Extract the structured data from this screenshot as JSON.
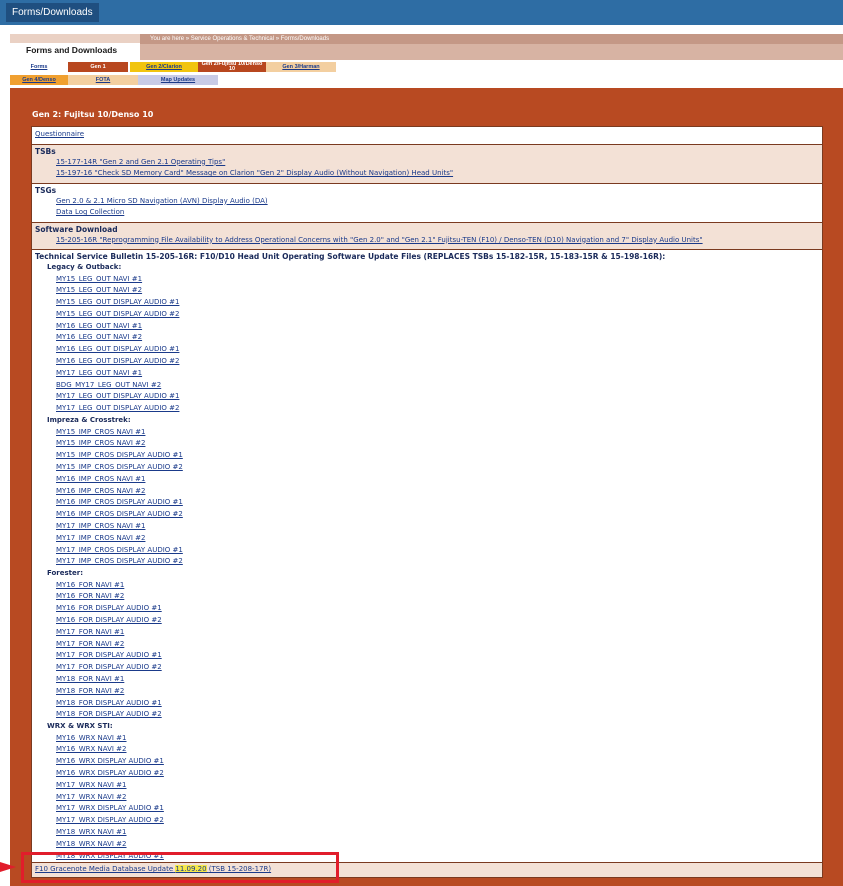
{
  "topbar": {
    "tab": "Forms/Downloads"
  },
  "banner": {
    "breadcrumb": "You are here » Service Operations & Technical » Forms/Downloads",
    "title": "Forms and Downloads"
  },
  "tabs_row1": [
    {
      "label": "Forms",
      "style": "white"
    },
    {
      "label": "Gen 1",
      "style": "active"
    },
    {
      "label": "Gen 2/Clarion",
      "style": "yellow"
    },
    {
      "label": "Gen 2/Fujitsu 10/Denso 10",
      "style": "active"
    },
    {
      "label": "Gen 3/Harman",
      "style": "peach"
    }
  ],
  "tabs_row2": [
    {
      "label": "Gen 4/Denso",
      "style": "orange"
    },
    {
      "label": "FOTA",
      "style": "peach"
    },
    {
      "label": "Map Updates",
      "style": "lilac"
    }
  ],
  "page_title": "Gen 2: Fujitsu 10/Denso 10",
  "questionnaire": "Questionnaire",
  "tsbs": {
    "heading": "TSBs",
    "items": [
      "15-177-14R \"Gen 2 and Gen 2.1 Operating Tips\"",
      "15-197-16 \"Check SD Memory Card\" Message on Clarion \"Gen 2\" Display Audio (Without Navigation) Head Units\""
    ]
  },
  "tsgs": {
    "heading": "TSGs",
    "items": [
      "Gen 2.0 & 2.1 Micro SD Navigation (AVN) Display Audio (DA)",
      "Data Log Collection"
    ]
  },
  "software": {
    "heading": "Software Download",
    "items": [
      "15-205-16R \"Reprogramming File Availability to Address Operational Concerns with \"Gen 2.0\" and \"Gen 2.1\" Fujitsu-TEN (F10) / Denso-TEN (D10) Navigation and 7\" Display Audio Units\""
    ]
  },
  "bulletin": {
    "heading": "Technical Service Bulletin 15-205-16R: F10/D10 Head Unit Operating Software Update Files (REPLACES TSBs 15-182-15R, 15-183-15R & 15-198-16R):",
    "groups": [
      {
        "name": "Legacy & Outback:",
        "items": [
          "MY15_LEG_OUT NAVI #1",
          "MY15_LEG_OUT NAVI #2",
          "MY15_LEG_OUT DISPLAY AUDIO #1",
          "MY15_LEG_OUT DISPLAY AUDIO #2",
          "MY16_LEG_OUT NAVI #1",
          "MY16_LEG_OUT NAVI #2",
          "MY16_LEG_OUT DISPLAY AUDIO #1",
          "MY16_LEG_OUT DISPLAY AUDIO #2",
          "MY17_LEG_OUT NAVI #1",
          "BDG_MY17_LEG_OUT NAVI #2",
          "MY17_LEG_OUT DISPLAY AUDIO #1",
          "MY17_LEG_OUT DISPLAY AUDIO #2"
        ]
      },
      {
        "name": "Impreza & Crosstrek:",
        "items": [
          "MY15_IMP_CROS NAVI #1",
          "MY15_IMP_CROS NAVI #2",
          "MY15_IMP_CROS DISPLAY AUDIO #1",
          "MY15_IMP_CROS DISPLAY AUDIO #2",
          "MY16_IMP_CROS NAVI #1",
          "MY16_IMP_CROS NAVI #2",
          "MY16_IMP_CROS DISPLAY AUDIO #1",
          "MY16_IMP_CROS DISPLAY AUDIO #2",
          "MY17_IMP_CROS NAVI #1",
          "MY17_IMP_CROS NAVI #2",
          "MY17_IMP_CROS DISPLAY AUDIO #1",
          "MY17_IMP_CROS DISPLAY AUDIO #2"
        ]
      },
      {
        "name": "Forester:",
        "items": [
          "MY16_FOR NAVI #1",
          "MY16_FOR NAVI #2",
          "MY16_FOR DISPLAY AUDIO #1",
          "MY16_FOR DISPLAY AUDIO #2",
          "MY17_FOR NAVI #1",
          "MY17_FOR NAVI #2",
          "MY17_FOR DISPLAY AUDIO #1",
          "MY17_FOR DISPLAY AUDIO #2",
          "MY18_FOR NAVI #1",
          "MY18_FOR NAVI #2",
          "MY18_FOR DISPLAY AUDIO #1",
          "MY18_FOR DISPLAY AUDIO #2"
        ]
      },
      {
        "name": "WRX & WRX STI:",
        "items": [
          "MY16_WRX NAVI #1",
          "MY16_WRX NAVI #2",
          "MY16_WRX DISPLAY AUDIO #1",
          "MY16_WRX DISPLAY AUDIO #2",
          "MY17_WRX NAVI #1",
          "MY17_WRX NAVI #2",
          "MY17_WRX DISPLAY AUDIO #1",
          "MY17_WRX DISPLAY AUDIO #2",
          "MY18_WRX NAVI #1",
          "MY18_WRX NAVI #2",
          "MY18_WRX DISPLAY AUDIO #1"
        ]
      }
    ]
  },
  "gracenote": {
    "label": "F10 Gracenote Media Database Update",
    "date": "11.09.20",
    "tsb": "(TSB 15-208-17R)"
  },
  "colors": {
    "topbar": "#2e6da4",
    "panel": "#b84a22",
    "highlight": "#e11d2b"
  }
}
